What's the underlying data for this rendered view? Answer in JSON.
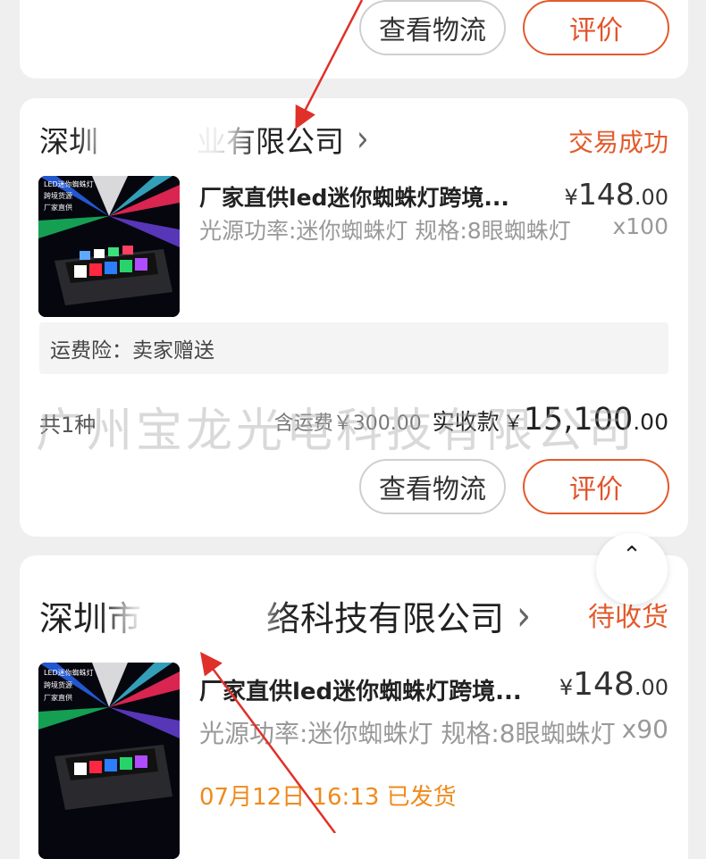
{
  "order_top": {
    "logistics_btn": "查看物流",
    "review_btn": "评价"
  },
  "order_mid": {
    "shop_name": "深圳 业有限公司",
    "shop_name_a": "深圳",
    "shop_name_b": "业有限公司",
    "status": "交易成功",
    "product": {
      "title": "厂家直供led迷你蜘蛛灯跨境...",
      "price_currency": "¥",
      "price_int": "148",
      "price_dec": ".00",
      "spec": "光源功率:迷你蜘蛛灯 规格:8眼蜘蛛灯",
      "qty": "x100",
      "thumb_text": [
        "LED迷你蜘蛛灯",
        "跨境货源",
        "厂家直供"
      ]
    },
    "insurance": "运费险：卖家赠送",
    "summary": {
      "count": "共1种",
      "shipping": "含运费￥300.00",
      "received_label": "实收款",
      "currency": "￥",
      "total_int": "15,100",
      "total_dec": ".00"
    },
    "logistics_btn": "查看物流",
    "review_btn": "评价"
  },
  "order_bot": {
    "shop_name_a": "深圳市",
    "shop_name_b": "络科技有限公司",
    "status": "待收货",
    "product": {
      "title": "厂家直供led迷你蜘蛛灯跨境...",
      "price_currency": "¥",
      "price_int": "148",
      "price_dec": ".00",
      "spec": "光源功率:迷你蜘蛛灯 规格:8眼蜘蛛灯",
      "qty": "x90",
      "thumb_text": [
        "LED迷你蜘蛛灯",
        "跨境货源",
        "厂家直供"
      ]
    },
    "ship_note": "07月12日 16:13 已发货"
  },
  "watermark": "广州宝龙光电科技有限公司",
  "icons": {
    "shop_chevron": "chevron-right-icon",
    "scroll_top": "chevron-up-icon"
  },
  "colors": {
    "accent": "#e35a2b",
    "shipped": "#ef8a1c",
    "annotation_arrow": "#e0302a"
  }
}
